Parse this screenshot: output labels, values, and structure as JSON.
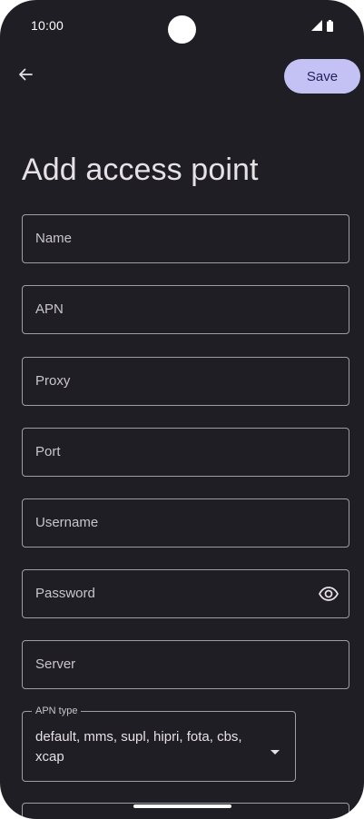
{
  "status_bar": {
    "time": "10:00",
    "icons": [
      "signal-icon",
      "battery-icon"
    ]
  },
  "toolbar": {
    "back_icon": "arrow-left-icon",
    "save_label": "Save"
  },
  "page": {
    "title": "Add access point"
  },
  "fields": {
    "name": {
      "label": "Name",
      "value": ""
    },
    "apn": {
      "label": "APN",
      "value": ""
    },
    "proxy": {
      "label": "Proxy",
      "value": ""
    },
    "port": {
      "label": "Port",
      "value": ""
    },
    "username": {
      "label": "Username",
      "value": ""
    },
    "password": {
      "label": "Password",
      "value": "",
      "toggle_icon": "eye-icon"
    },
    "server": {
      "label": "Server",
      "value": ""
    }
  },
  "apn_type": {
    "label": "APN type",
    "value": "default, mms, supl, hipri, fota, cbs, xcap",
    "icon": "dropdown-arrow-icon"
  },
  "colors": {
    "background": "#1f1e24",
    "accent": "#c4c2f5",
    "outline": "#a09da6",
    "text": "#e6e1e5"
  }
}
